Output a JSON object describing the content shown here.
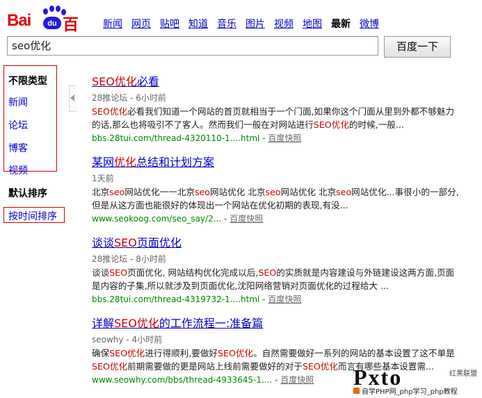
{
  "logo": {
    "text_bai": "Bai",
    "text_du": "du",
    "text_cn": "百度"
  },
  "nav": [
    "新闻",
    "网页",
    "贴吧",
    "知道",
    "音乐",
    "图片",
    "视频",
    "地图",
    "最新",
    "微博"
  ],
  "search": {
    "query": "seo优化",
    "button": "百度一下"
  },
  "sidebar": {
    "types": [
      "不限类型",
      "新闻",
      "论坛",
      "博客",
      "视频"
    ],
    "sort_title": "默认排序",
    "sort_by_time": "按时间排序"
  },
  "results": [
    {
      "title_pre": "",
      "title_em": "SEO优化",
      "title_post": "必看",
      "meta": "28推论坛 - 6小时前",
      "abs_parts": [
        [
          "SEO优化",
          true
        ],
        [
          "必看我们知道一个网站的首页就相当于一个门面,如果你这个门面从里到外都不够魅力的话,那么也将吸引不了客人。然而我们一般在对网站进行",
          false
        ],
        [
          "SEO优化",
          true
        ],
        [
          "的时候,一般...",
          false
        ]
      ],
      "url": "bbs.28tui.com/thread-4320110-1....html",
      "snap": "百度快照"
    },
    {
      "title_pre": "某网",
      "title_em": "优化",
      "title_post": "总结和计划方案",
      "meta": "1天前",
      "abs_parts": [
        [
          "北京",
          false
        ],
        [
          "seo",
          true
        ],
        [
          "网站优化一一北京",
          false
        ],
        [
          "seo",
          true
        ],
        [
          "网站优化 北京",
          false
        ],
        [
          "seo",
          true
        ],
        [
          "网站优化 北京",
          false
        ],
        [
          "seo",
          true
        ],
        [
          "网站优化...事很小的一部分,但是从这方面也能很好的体现出一个网站在优化初期的表现,有没...",
          false
        ]
      ],
      "url": "www.seokoog.com/seo_say/2...",
      "snap": "百度快照"
    },
    {
      "title_pre": "谈谈",
      "title_em": "SEO",
      "title_post": "页面优化",
      "meta": "28推论坛 - 8小时前",
      "abs_parts": [
        [
          "谈谈",
          false
        ],
        [
          "SEO",
          true
        ],
        [
          "页面优化, 网站结构优化完成以后,",
          false
        ],
        [
          "SEO",
          true
        ],
        [
          "的实质就是内容建设与外链建设这两方面,页面是内容的子集,所以就涉及到页面优化,沈阳网络营销对页面优化的过程给大 ...",
          false
        ]
      ],
      "url": "bbs.28tui.com/thread-4319732-1....html",
      "snap": "百度快照"
    },
    {
      "title_pre": "详解",
      "title_em": "SEO优化",
      "title_post": "的工作流程一:准备篇",
      "meta": "seowhy - 4小时前",
      "abs_parts": [
        [
          "确保",
          false
        ],
        [
          "SEO优化",
          true
        ],
        [
          "进行得顺利,要做好",
          false
        ],
        [
          "SEO优化",
          true
        ],
        [
          "。自然需要做好一系列的网站的基本设置了这不单是",
          false
        ],
        [
          "SEO优化",
          true
        ],
        [
          "前期需要做的更是网站上线前需要做好的对于",
          false
        ],
        [
          "SEO优化",
          true
        ],
        [
          "而言有哪些基本设置需...",
          false
        ]
      ],
      "url": "www.seowhy.com/bbs/thread-4933645-1....",
      "snap": "百度快照"
    }
  ],
  "watermark": {
    "big": "Pxto",
    "tag": "红黑联盟",
    "small": "自学PHP网_php学习_php教程"
  },
  "colors": {
    "brand_red": "#e10601",
    "brand_blue": "#2319dc",
    "link": "#0000cc",
    "url_green": "#008000",
    "highlight": "#cc0000",
    "annotation_box": "#d40000"
  }
}
